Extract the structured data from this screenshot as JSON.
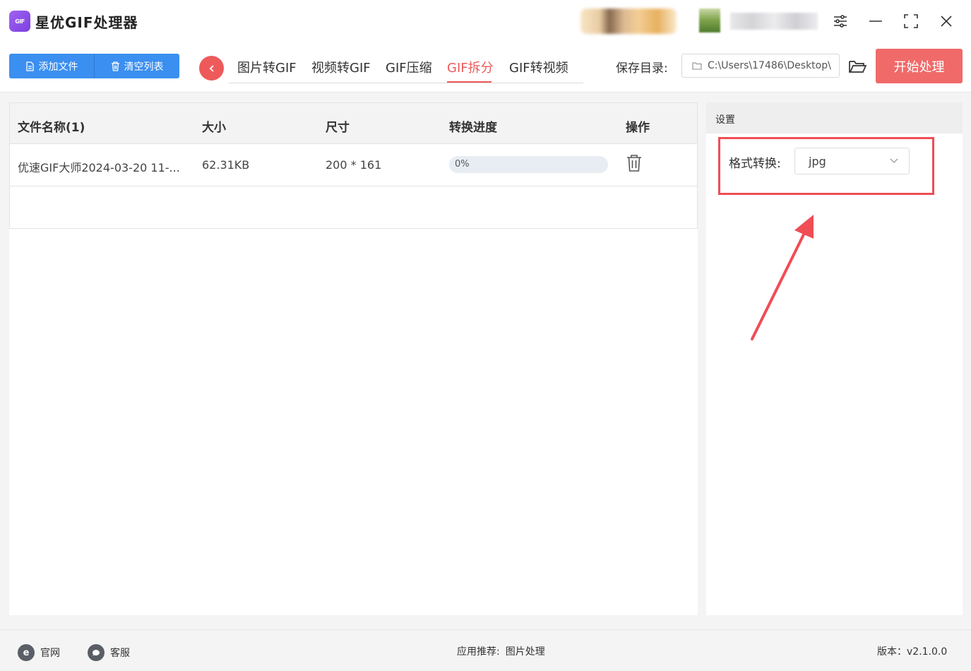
{
  "app": {
    "title": "星优GIF处理器",
    "logo_text": "GIF"
  },
  "toolbar": {
    "add_file": "添加文件",
    "clear_list": "清空列表",
    "tabs": [
      "图片转GIF",
      "视频转GIF",
      "GIF压缩",
      "GIF拆分",
      "GIF转视频"
    ],
    "active_tab": "GIF拆分",
    "save_dir_label": "保存目录:",
    "save_dir_path": "C:\\Users\\17486\\Desktop\\",
    "start": "开始处理"
  },
  "table": {
    "headers": [
      "文件名称(1)",
      "大小",
      "尺寸",
      "转换进度",
      "操作"
    ],
    "rows": [
      {
        "name": "优速GIF大师2024-03-20 11-...",
        "size": "62.31KB",
        "dimensions": "200 * 161",
        "progress_text": "0%",
        "progress": 0
      }
    ]
  },
  "settings": {
    "title": "设置",
    "format_label": "格式转换:",
    "format_value": "jpg"
  },
  "footer": {
    "website": "官网",
    "support": "客服",
    "recommend_label": "应用推荐:",
    "recommend_value": "图片处理",
    "version": "版本：v2.1.0.0"
  },
  "colors": {
    "accent_red": "#ee5a5a",
    "primary_blue": "#3b8ff0",
    "highlight": "#f04d55"
  }
}
